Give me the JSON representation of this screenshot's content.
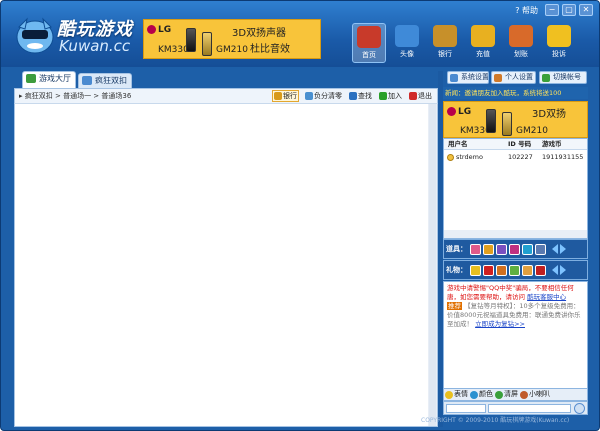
{
  "window": {
    "help_label": "? 帮助",
    "minimize": "−",
    "restore": "▢",
    "close": "✕"
  },
  "logo": {
    "cn": "酷玩游戏",
    "en": "Kuwan.cc"
  },
  "top_ad": {
    "brand": "LG",
    "model1": "KM330",
    "model2": "GM210",
    "line1": "3D双扬声器",
    "line2": "杜比音效"
  },
  "toolbar": [
    {
      "label": "首页",
      "color": "#c83a2a",
      "selected": true
    },
    {
      "label": "头像",
      "color": "#3f8ad8"
    },
    {
      "label": "银行",
      "color": "#c7902a"
    },
    {
      "label": "充值",
      "color": "#e8b020"
    },
    {
      "label": "划账",
      "color": "#d86a2a"
    },
    {
      "label": "投诉",
      "color": "#f0c020"
    }
  ],
  "tabs": [
    {
      "label": "游戏大厅",
      "selected": true
    },
    {
      "label": "疯狂双扣"
    }
  ],
  "breadcrumb": [
    "疯狂双扣",
    "普通场一",
    "普通场36"
  ],
  "left_tools": [
    {
      "label": "银行",
      "color": "#d89a1a"
    },
    {
      "label": "负分清零",
      "color": "#4a90d0"
    },
    {
      "label": "查找",
      "color": "#2a70c0"
    },
    {
      "label": "加入",
      "color": "#2aa02a"
    },
    {
      "label": "退出",
      "color": "#d02a2a"
    }
  ],
  "right_buttons": [
    {
      "label": "系统设置",
      "color": "#4a8ad0"
    },
    {
      "label": "个人设置",
      "color": "#d07a2a"
    },
    {
      "label": "切换帐号",
      "color": "#3aa03a"
    }
  ],
  "notice": "新闻：邀请朋友加入酷玩，系统将送100",
  "side_ad": {
    "brand": "LG",
    "model1": "KM330",
    "model2": "GM210",
    "text": "3D双扬"
  },
  "users": {
    "headers": [
      "用户名",
      "ID 号码",
      "游戏币"
    ],
    "rows": [
      {
        "name": "strdemo",
        "id": "102227",
        "coins": "1911931155"
      }
    ]
  },
  "tools_bar": {
    "label": "道具：",
    "icons": [
      "#e05a8a",
      "#e0a020",
      "#7a50c0",
      "#c03080",
      "#20a0d0",
      "#5a7ab0"
    ]
  },
  "gift_bar": {
    "label": "礼物：",
    "icons": [
      "#e8c020",
      "#d02020",
      "#d07020",
      "#60b040",
      "#e0a040",
      "#c02020"
    ]
  },
  "chat": {
    "warning": "游戏中请警惕\"QQ中奖\"骗局，不要相信任何唐，如您需要帮助，请访问",
    "warning_link": "酷玩客服中心",
    "tag": "推荐",
    "promo": "【复钻等月特权】：10多个复级免费用：价值8000元祝福道具免费用：联通免费讲你乐至加成！",
    "promo_link": "立即成为复钻>>"
  },
  "chat_bar": [
    {
      "label": "表情",
      "color": "#e8c020"
    },
    {
      "label": "颜色",
      "color": "#2a90d0"
    },
    {
      "label": "清屏",
      "color": "#3aa03a"
    },
    {
      "label": "小喇叭",
      "color": "#c05a2a"
    }
  ],
  "copyright": "COPYRIGHT © 2009-2010 酷玩棋牌游戏(Kuwan.cc)"
}
